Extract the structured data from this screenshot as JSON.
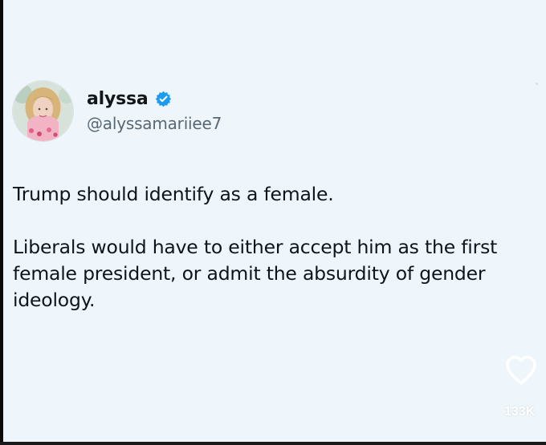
{
  "tweet": {
    "author": {
      "display_name": "alyssa",
      "handle": "@alyssamariiee7",
      "verified": true
    },
    "paragraphs": [
      "Trump should identify as a female.",
      "Liberals would have to either accept him as the first female president, or admit the absurdity of gender ideology."
    ]
  },
  "reactions": {
    "likes": "133K"
  },
  "icons": {
    "avatar": "avatar-icon",
    "verified": "verified-badge-icon",
    "like": "heart-icon"
  },
  "colors": {
    "background": "#eef6fb",
    "verified_blue": "#1d9bf0",
    "handle_gray": "#596773",
    "heart_overlay": "#ffffff"
  }
}
